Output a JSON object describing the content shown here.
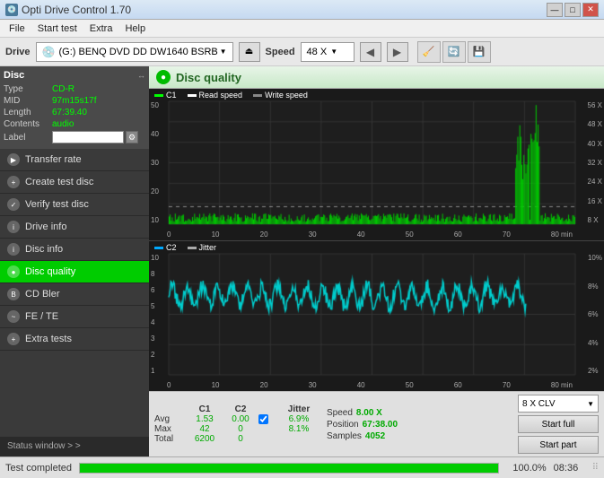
{
  "titlebar": {
    "icon": "💿",
    "title": "Opti Drive Control 1.70",
    "minimize": "—",
    "maximize": "□",
    "close": "✕"
  },
  "menubar": {
    "items": [
      "File",
      "Start test",
      "Extra",
      "Help"
    ]
  },
  "drivebar": {
    "label": "Drive",
    "drive_value": "(G:)  BENQ DVD DD DW1640 BSRB",
    "speed_label": "Speed",
    "speed_value": "48 X"
  },
  "disc_panel": {
    "title": "Disc",
    "rows": [
      {
        "label": "Type",
        "value": "CD-R",
        "green": true
      },
      {
        "label": "MID",
        "value": "97m15s17f",
        "green": true
      },
      {
        "label": "Length",
        "value": "67:39.40",
        "green": true
      },
      {
        "label": "Contents",
        "value": "audio",
        "green": true
      },
      {
        "label": "Label",
        "value": "",
        "input": true
      }
    ]
  },
  "sidebar": {
    "items": [
      {
        "id": "transfer-rate",
        "label": "Transfer rate",
        "active": false
      },
      {
        "id": "create-test-disc",
        "label": "Create test disc",
        "active": false
      },
      {
        "id": "verify-test-disc",
        "label": "Verify test disc",
        "active": false
      },
      {
        "id": "drive-info",
        "label": "Drive info",
        "active": false
      },
      {
        "id": "disc-info",
        "label": "Disc info",
        "active": false
      },
      {
        "id": "disc-quality",
        "label": "Disc quality",
        "active": true
      },
      {
        "id": "cd-bler",
        "label": "CD Bler",
        "active": false
      },
      {
        "id": "fe-te",
        "label": "FE / TE",
        "active": false
      },
      {
        "id": "extra-tests",
        "label": "Extra tests",
        "active": false
      }
    ],
    "status_window": "Status window > >"
  },
  "content": {
    "title": "Disc quality",
    "chart1": {
      "legend": [
        {
          "label": "C1",
          "color": "#00ff00"
        },
        {
          "label": "Read speed",
          "color": "#ffffff"
        },
        {
          "label": "Write speed",
          "color": "#888888"
        }
      ],
      "y_max": "56 X",
      "y_labels": [
        "56 X",
        "48 X",
        "40 X",
        "32 X",
        "24 X",
        "16 X",
        "8 X"
      ],
      "x_labels": [
        "0",
        "10",
        "20",
        "30",
        "40",
        "50",
        "60",
        "70",
        "80 min"
      ]
    },
    "chart2": {
      "legend": [
        {
          "label": "C2",
          "color": "#00aaff"
        },
        {
          "label": "Jitter",
          "color": "#aaaaaa"
        }
      ],
      "y_labels": [
        "10%",
        "8%",
        "6%",
        "4%",
        "2%"
      ],
      "x_labels": [
        "0",
        "10",
        "20",
        "30",
        "40",
        "50",
        "60",
        "70",
        "80 min"
      ]
    }
  },
  "stats": {
    "headers": [
      "",
      "C1",
      "C2",
      "",
      "Jitter"
    ],
    "avg_label": "Avg",
    "avg_c1": "1.53",
    "avg_c2": "0.00",
    "avg_jitter": "6.9%",
    "max_label": "Max",
    "max_c1": "42",
    "max_c2": "0",
    "max_jitter": "8.1%",
    "total_label": "Total",
    "total_c1": "6200",
    "total_c2": "0",
    "speed_label": "Speed",
    "speed_value": "8.00 X",
    "position_label": "Position",
    "position_value": "67:38.00",
    "samples_label": "Samples",
    "samples_value": "4052",
    "jitter_checked": true,
    "speed_dropdown": "8 X CLV",
    "start_full": "Start full",
    "start_part": "Start part"
  },
  "statusbar": {
    "text": "Test completed",
    "progress": 100.0,
    "progress_text": "100.0%",
    "time": "08:36"
  }
}
